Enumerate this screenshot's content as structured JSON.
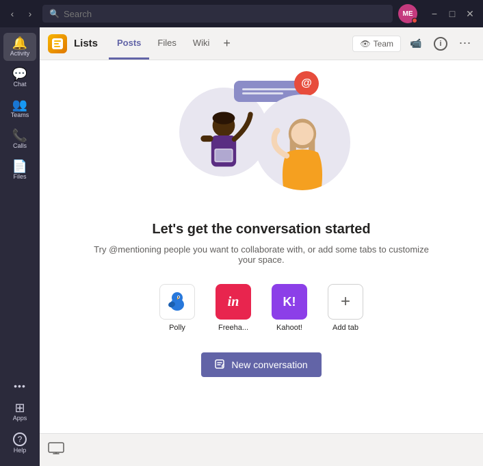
{
  "titlebar": {
    "search_placeholder": "Search",
    "avatar_initials": "ME",
    "window_controls": [
      "−",
      "□",
      "✕"
    ],
    "nav_back": "‹",
    "nav_forward": "›"
  },
  "sidebar": {
    "items": [
      {
        "id": "activity",
        "label": "Activity",
        "icon": "🔔"
      },
      {
        "id": "chat",
        "label": "Chat",
        "icon": "💬"
      },
      {
        "id": "teams",
        "label": "Teams",
        "icon": "👥"
      },
      {
        "id": "calls",
        "label": "Calls",
        "icon": "📞"
      },
      {
        "id": "files",
        "label": "Files",
        "icon": "📄"
      }
    ],
    "bottom_items": [
      {
        "id": "more",
        "label": "...",
        "icon": "···"
      },
      {
        "id": "apps",
        "label": "Apps",
        "icon": "⊞"
      },
      {
        "id": "help",
        "label": "Help",
        "icon": "?"
      }
    ]
  },
  "topbar": {
    "channel_title": "Lists",
    "tabs": [
      {
        "id": "posts",
        "label": "Posts",
        "active": true
      },
      {
        "id": "files",
        "label": "Files",
        "active": false
      },
      {
        "id": "wiki",
        "label": "Wiki",
        "active": false
      }
    ],
    "add_tab_label": "+",
    "team_btn": "Team",
    "video_icon": "📹",
    "info_icon": "ℹ",
    "more_icon": "⋯"
  },
  "main": {
    "headline": "Let's get the conversation started",
    "subtext": "Try @mentioning people you want to collaborate with, or add some tabs to customize your space.",
    "apps": [
      {
        "id": "polly",
        "label": "Polly",
        "color": "white",
        "type": "polly"
      },
      {
        "id": "freehand",
        "label": "Freeha...",
        "color": "#e8254e",
        "type": "freehand",
        "text": "in"
      },
      {
        "id": "kahoot",
        "label": "Kahoot!",
        "color": "#8c3fe8",
        "type": "kahoot",
        "text": "K!"
      },
      {
        "id": "add-tab",
        "label": "Add tab",
        "color": "white",
        "type": "add-tab",
        "text": "+"
      }
    ],
    "new_conversation_btn": "New conversation"
  }
}
